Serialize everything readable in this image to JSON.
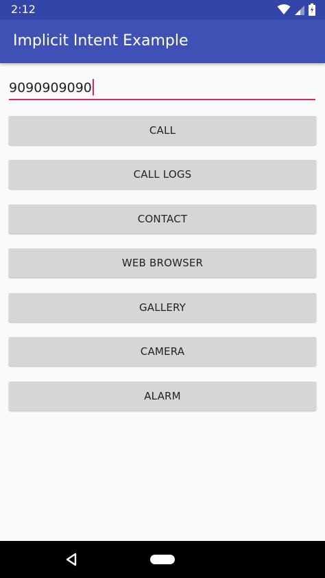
{
  "status_bar": {
    "time": "2:12",
    "icons": [
      "wifi-icon",
      "signal-icon",
      "battery-icon"
    ]
  },
  "app_bar": {
    "title": "Implicit Intent Example",
    "color": "#3f51b5"
  },
  "phone_input": {
    "value": "9090909090",
    "accent_color": "#e91e63"
  },
  "buttons": [
    {
      "label": "CALL"
    },
    {
      "label": "CALL LOGS"
    },
    {
      "label": "CONTACT"
    },
    {
      "label": "WEB BROWSER"
    },
    {
      "label": "GALLERY"
    },
    {
      "label": "CAMERA"
    },
    {
      "label": "ALARM"
    }
  ],
  "nav_bar": {
    "icons": [
      "back-icon",
      "home-icon"
    ]
  }
}
